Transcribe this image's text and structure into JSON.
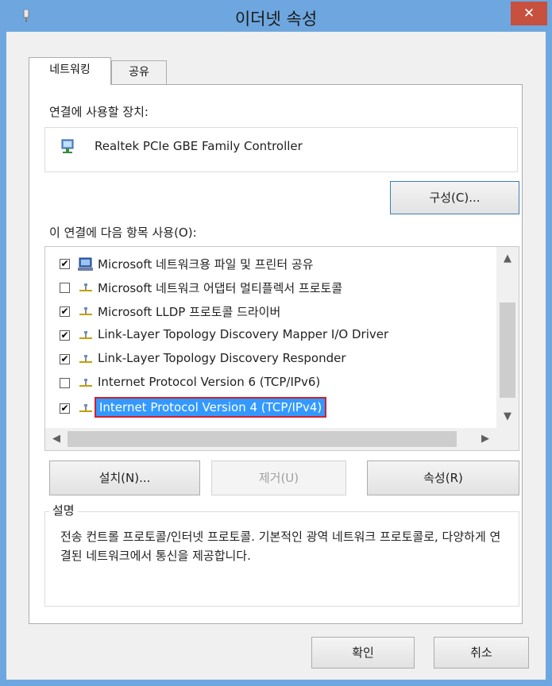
{
  "window": {
    "title": "이더넷 속성",
    "close_label": "✕"
  },
  "tabs": [
    {
      "label": "네트워킹"
    },
    {
      "label": "공유"
    }
  ],
  "networking": {
    "connect_using_label": "연결에 사용할 장치:",
    "device_name": "Realtek PCIe GBE Family Controller",
    "configure_label": "구성(C)...",
    "items_label": "이 연결에 다음 항목 사용(O):",
    "items": [
      {
        "label": "Microsoft 네트워크용 파일 및 프린터 공유",
        "checked": "✔",
        "icon": "shared-computer-icon"
      },
      {
        "label": "Microsoft 네트워크 어댑터 멀티플렉서 프로토콜",
        "checked": "",
        "icon": "protocol-icon"
      },
      {
        "label": "Microsoft LLDP 프로토콜 드라이버",
        "checked": "✔",
        "icon": "protocol-icon"
      },
      {
        "label": "Link-Layer Topology Discovery Mapper I/O Driver",
        "checked": "✔",
        "icon": "protocol-icon"
      },
      {
        "label": "Link-Layer Topology Discovery Responder",
        "checked": "✔",
        "icon": "protocol-icon"
      },
      {
        "label": "Internet Protocol Version 6 (TCP/IPv6)",
        "checked": "",
        "icon": "protocol-icon"
      },
      {
        "label": "Internet Protocol Version 4 (TCP/IPv4)",
        "checked": "✔",
        "icon": "protocol-icon",
        "selected": true
      }
    ],
    "install_label": "설치(N)...",
    "uninstall_label": "제거(U)",
    "properties_label": "속성(R)",
    "description_title": "설명",
    "description_text": "전송 컨트롤 프로토콜/인터넷 프로토콜. 기본적인 광역 네트워크 프로토콜로, 다양하게 연결된 네트워크에서 통신을 제공합니다."
  },
  "footer": {
    "ok_label": "확인",
    "cancel_label": "취소"
  },
  "colors": {
    "frame": "#6ea7df",
    "close": "#c7503f",
    "selection": "#3399ff",
    "highlight_outline": "#d21e2d"
  }
}
